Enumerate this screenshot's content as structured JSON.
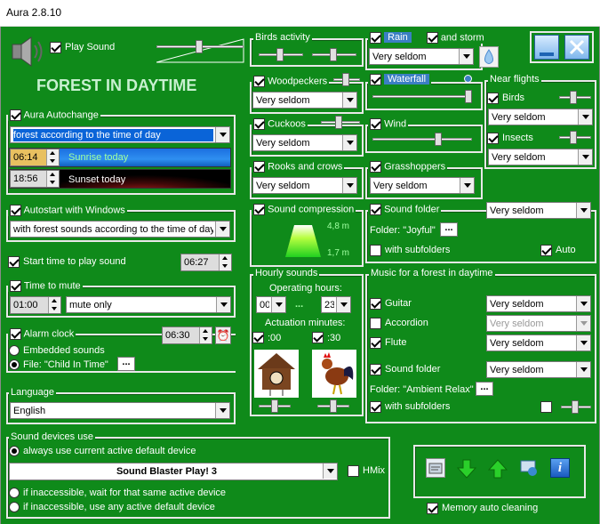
{
  "window": {
    "title": "Aura 2.8.10"
  },
  "play_sound": {
    "label": "Play Sound"
  },
  "heading": "FOREST IN DAYTIME",
  "autochange": {
    "label": "Aura Autochange",
    "mode": "forest according to the time of day",
    "sunrise_time": "06:14",
    "sunrise_label": "Sunrise today",
    "sunset_time": "18:56",
    "sunset_label": "Sunset today"
  },
  "autostart": {
    "label": "Autostart with Windows",
    "mode": "with forest sounds according to the time of day"
  },
  "start_time": {
    "label": "Start time to play sound",
    "value": "06:27"
  },
  "mute": {
    "label": "Time to mute",
    "time": "01:00",
    "mode": "mute only"
  },
  "alarm": {
    "label": "Alarm clock",
    "time": "06:30",
    "embedded": "Embedded sounds",
    "file": "File: \"Child In Time\""
  },
  "language": {
    "label": "Language",
    "value": "English"
  },
  "devices": {
    "label": "Sound devices use",
    "opt1": "always use current active default device",
    "device": "Sound Blaster Play! 3",
    "hmix": "HMix",
    "opt2": "if inaccessible, wait for that same active device",
    "opt3": "if inaccessible, use any active default device"
  },
  "birds_activity": {
    "label": "Birds activity"
  },
  "woodpeckers": {
    "label": "Woodpeckers",
    "freq": "Very seldom"
  },
  "cuckoos": {
    "label": "Cuckoos",
    "freq": "Very seldom"
  },
  "rooks": {
    "label": "Rooks and crows",
    "freq": "Very seldom"
  },
  "compression": {
    "label": "Sound compression",
    "top": "4,8 m",
    "bottom": "1,7 m"
  },
  "hourly": {
    "label": "Hourly sounds",
    "op_hours": "Operating hours:",
    "from": "00",
    "dots": "...",
    "to": "23",
    "act_minutes": "Actuation minutes:",
    "min1": ":00",
    "min2": ":30"
  },
  "rain": {
    "label": "Rain",
    "storm": "and storm",
    "freq": "Very seldom"
  },
  "waterfall": {
    "label": "Waterfall"
  },
  "wind": {
    "label": "Wind"
  },
  "grasshoppers": {
    "label": "Grasshoppers",
    "freq": "Very seldom"
  },
  "sound_folder": {
    "label": "Sound folder",
    "freq": "Very seldom",
    "folder": "Folder: \"Joyful\"",
    "sub": "with subfolders",
    "auto": "Auto"
  },
  "near": {
    "label": "Near flights",
    "birds": "Birds",
    "birds_freq": "Very seldom",
    "insects": "Insects",
    "insects_freq": "Very seldom"
  },
  "music": {
    "label": "Music for a forest in daytime",
    "guitar": "Guitar",
    "guitar_freq": "Very seldom",
    "accordion": "Accordion",
    "accordion_freq": "Very seldom",
    "flute": "Flute",
    "flute_freq": "Very seldom",
    "folder_label": "Sound folder",
    "folder_freq": "Very seldom",
    "folder": "Folder: \"Ambient Relax\"",
    "sub": "with subfolders"
  },
  "memory": {
    "label": "Memory auto cleaning"
  },
  "browse_label": "...",
  "colors": {
    "background": "#0f8a1a",
    "accent": "#0a64d8",
    "border": "#e8e8e8"
  }
}
